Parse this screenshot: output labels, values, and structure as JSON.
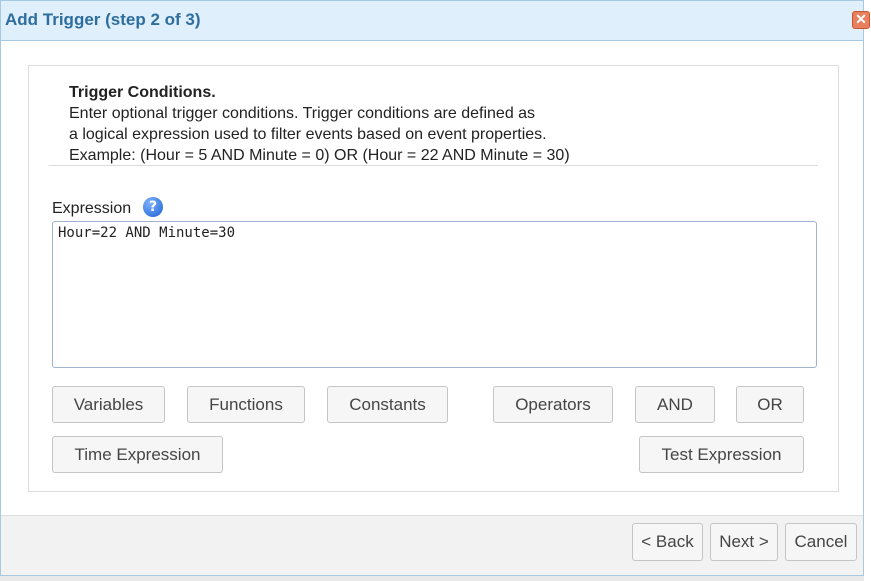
{
  "dialog": {
    "title": "Add Trigger (step 2 of 3)",
    "close_icon": "close-icon",
    "close_glyph": "✕"
  },
  "info": {
    "heading": "Trigger Conditions.",
    "line1": "Enter optional trigger conditions. Trigger conditions are defined as",
    "line2": "a logical expression used to filter events based on event properties.",
    "line3": "Example: (Hour = 5 AND Minute = 0) OR (Hour = 22 AND Minute = 30)"
  },
  "expression": {
    "label": "Expression",
    "help_icon": "help-icon",
    "help_glyph": "?",
    "value": "Hour=22 AND Minute=30"
  },
  "buttons": {
    "variables": "Variables",
    "functions": "Functions",
    "constants": "Constants",
    "operators": "Operators",
    "and": "AND",
    "or": "OR",
    "time_expression": "Time Expression",
    "test_expression": "Test Expression"
  },
  "footer": {
    "back": "< Back",
    "next": "Next >",
    "cancel": "Cancel"
  },
  "colors": {
    "titlebar_bg": "#dfeffc",
    "title_text": "#2e6e9e",
    "close_button": "#e87f5e",
    "help_icon": "#1a5fcf"
  }
}
